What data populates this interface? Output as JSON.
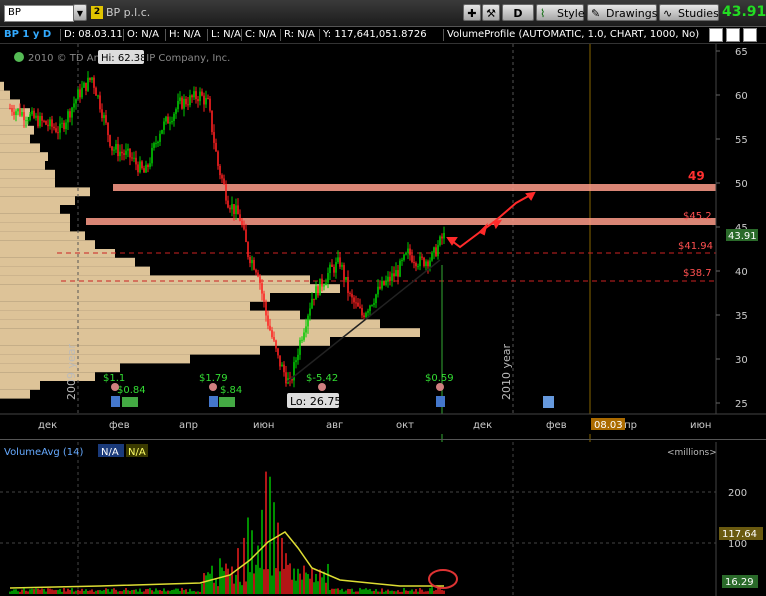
{
  "toolbar": {
    "symbol": "BP",
    "link_badge": "2",
    "company": "BP p.l.c.",
    "period_button": "D",
    "style_label": "Style",
    "drawings_label": "Drawings",
    "studies_label": "Studies",
    "last_price": "43.91"
  },
  "infobar": {
    "title": "BP 1 y D",
    "date": "D: 08.03.11",
    "open": "O: N/A",
    "high": "H: N/A",
    "low": "L: N/A",
    "close": "C: N/A",
    "range": "R: N/A",
    "y": "Y: 117,641,051.8726",
    "volume_profile": "VolumeProfile (AUTOMATIC, 1.0, CHART, 1000, No)"
  },
  "chart": {
    "copyright": "2010 © TD Ameritrade IP Company, Inc.",
    "high_label": "Hi: 62.38",
    "low_label": "Lo: 26.75",
    "year_2009": "2009 year",
    "year_2010": "2010 year",
    "price_axis": [
      "65",
      "60",
      "55",
      "50",
      "45",
      "40",
      "35",
      "30",
      "25"
    ],
    "time_axis": [
      "дек",
      "фев",
      "апр",
      "июн",
      "авг",
      "окт",
      "дек",
      "фев",
      "апр",
      "июн"
    ],
    "current_date_tag": "08.03",
    "price_tag": "43.91",
    "levels": [
      "49",
      "$45.2",
      "$41.94",
      "$38.7"
    ],
    "dividends": [
      "$1.1",
      "$0.84",
      "$1.79",
      "$.84",
      "$-5.42",
      "$0.59"
    ]
  },
  "volume": {
    "label": "VolumeAvg (14)",
    "v1": "N/A",
    "v2": "N/A",
    "units": "<millions>",
    "axis": [
      "200",
      "100"
    ],
    "tag_avg": "117.64",
    "tag_vol": "16.29"
  },
  "colors": {
    "up": "#00cc00",
    "down": "#ff2020",
    "level_band": "#ff9c8a",
    "profile": "#f5d8a8"
  }
}
